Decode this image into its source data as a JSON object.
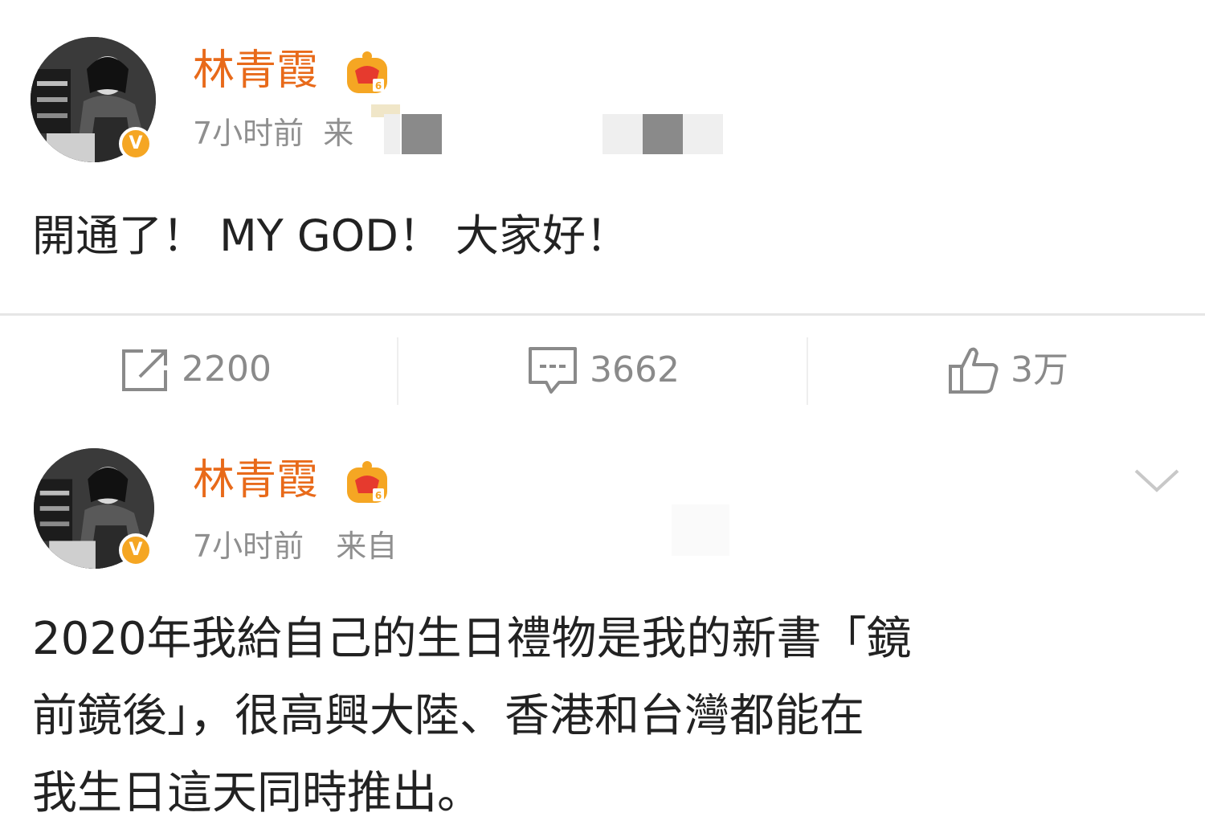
{
  "posts": [
    {
      "username": "林青霞",
      "time": "7小时前",
      "source_prefix": "来",
      "text_lines": [
        "開通了！ MY GOD！ 大家好！"
      ],
      "actions": {
        "repost": {
          "icon": "share-icon",
          "count": "2200"
        },
        "comment": {
          "icon": "comment-icon",
          "count": "3662"
        },
        "like": {
          "icon": "thumbs-up-icon",
          "count": "3万"
        }
      }
    },
    {
      "username": "林青霞",
      "time": "7小时前",
      "source_prefix": "来自",
      "text_lines": [
        "2020年我給自己的生日禮物是我的新書「鏡",
        "前鏡後」，很高興大陸、香港和台灣都能在",
        "我生日這天同時推出。"
      ]
    }
  ],
  "badges": {
    "verified": "V"
  },
  "colors": {
    "username": "#e86a1a",
    "meta": "#8f8f8f",
    "text": "#222222",
    "verified_badge": "#f5a623",
    "crown": "#f5a623"
  }
}
